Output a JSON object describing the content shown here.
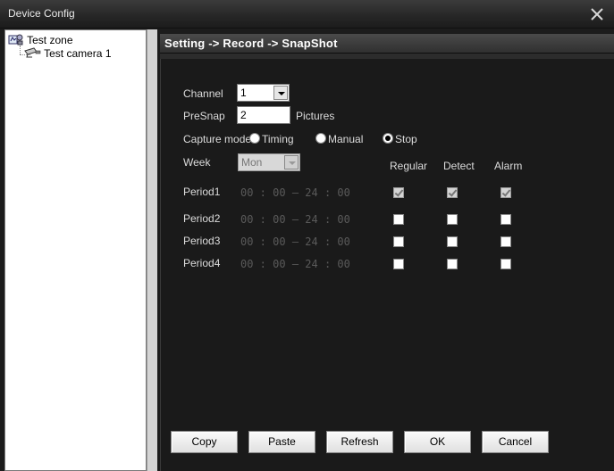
{
  "window": {
    "title": "Device Config"
  },
  "tree": {
    "root": {
      "label": "Test zone"
    },
    "child": {
      "label": "Test camera 1"
    }
  },
  "panel": {
    "breadcrumb": "Setting -> Record -> SnapShot"
  },
  "form": {
    "channel_label": "Channel",
    "channel_value": "1",
    "presnap_label": "PreSnap",
    "presnap_value": "2",
    "presnap_unit": "Pictures",
    "capture_mode_label": "Capture mode",
    "capture_modes": [
      {
        "label": "Timing",
        "selected": false
      },
      {
        "label": "Manual",
        "selected": false
      },
      {
        "label": "Stop",
        "selected": true
      }
    ],
    "week_label": "Week",
    "week_value": "Mon",
    "columns": [
      "Regular",
      "Detect",
      "Alarm"
    ],
    "periods": [
      {
        "label": "Period1",
        "start_h": "00",
        "start_m": "00",
        "end_h": "24",
        "end_m": "00",
        "regular": true,
        "detect": true,
        "alarm": true
      },
      {
        "label": "Period2",
        "start_h": "00",
        "start_m": "00",
        "end_h": "24",
        "end_m": "00",
        "regular": false,
        "detect": false,
        "alarm": false
      },
      {
        "label": "Period3",
        "start_h": "00",
        "start_m": "00",
        "end_h": "24",
        "end_m": "00",
        "regular": false,
        "detect": false,
        "alarm": false
      },
      {
        "label": "Period4",
        "start_h": "00",
        "start_m": "00",
        "end_h": "24",
        "end_m": "00",
        "regular": false,
        "detect": false,
        "alarm": false
      }
    ]
  },
  "buttons": {
    "copy": "Copy",
    "paste": "Paste",
    "refresh": "Refresh",
    "ok": "OK",
    "cancel": "Cancel"
  },
  "icons": {
    "close": "close-icon",
    "zone": "zone-icon",
    "camera": "camera-icon"
  }
}
